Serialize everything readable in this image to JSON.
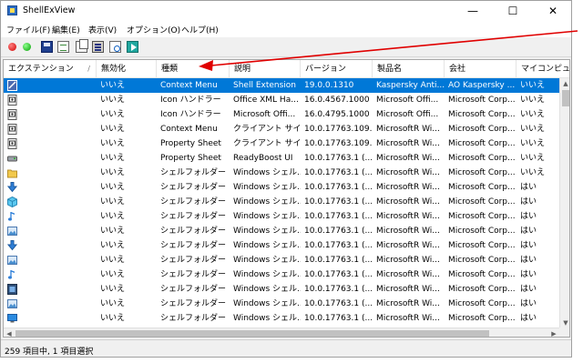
{
  "window": {
    "title": "ShellExView",
    "min_glyph": "—",
    "max_glyph": "☐",
    "close_glyph": "✕"
  },
  "menu": [
    "ファイル(F)",
    "編集(E)",
    "表示(V)",
    "オプション(O)",
    "ヘルプ(H)"
  ],
  "toolbar": [
    "red-dot-icon",
    "green-dot-icon",
    "save-icon",
    "refresh-icon",
    "copy-icon",
    "properties-icon",
    "find-icon",
    "exit-icon"
  ],
  "columns": [
    "エクステンション",
    "無効化",
    "種類",
    "説明",
    "バージョン",
    "製品名",
    "会社",
    "マイコンピュータ"
  ],
  "sort_indicator": "/",
  "rows": [
    {
      "icon": "shell-ext-icon",
      "disabled": "いいえ",
      "type": "Context Menu",
      "desc": "Shell Extension",
      "version": "19.0.0.1310",
      "product": "Kaspersky Anti...",
      "company": "AO Kaspersky ...",
      "mycomputer": "いいえ",
      "selected": true
    },
    {
      "icon": "document-icon",
      "disabled": "いいえ",
      "type": "Icon ハンドラー",
      "desc": "Office XML Ha...",
      "version": "16.0.4567.1000",
      "product": "Microsoft Offi...",
      "company": "Microsoft Corp...",
      "mycomputer": "いいえ"
    },
    {
      "icon": "document-icon",
      "disabled": "いいえ",
      "type": "Icon ハンドラー",
      "desc": "Microsoft Offi...",
      "version": "16.0.4795.1000",
      "product": "Microsoft Offi...",
      "company": "Microsoft Corp...",
      "mycomputer": "いいえ"
    },
    {
      "icon": "document-icon",
      "disabled": "いいえ",
      "type": "Context Menu",
      "desc": "クライアント サイ...",
      "version": "10.0.17763.109...",
      "product": "MicrosoftR Wi...",
      "company": "Microsoft Corp...",
      "mycomputer": "いいえ"
    },
    {
      "icon": "document-icon",
      "disabled": "いいえ",
      "type": "Property Sheet",
      "desc": "クライアント サイ...",
      "version": "10.0.17763.109...",
      "product": "MicrosoftR Wi...",
      "company": "Microsoft Corp...",
      "mycomputer": "いいえ"
    },
    {
      "icon": "drive-icon",
      "disabled": "いいえ",
      "type": "Property Sheet",
      "desc": "ReadyBoost UI",
      "version": "10.0.17763.1 (...",
      "product": "MicrosoftR Wi...",
      "company": "Microsoft Corp...",
      "mycomputer": "いいえ"
    },
    {
      "icon": "folder-lock-icon",
      "disabled": "いいえ",
      "type": "シェルフォルダー",
      "desc": "Windows シェル...",
      "version": "10.0.17763.1 (...",
      "product": "MicrosoftR Wi...",
      "company": "Microsoft Corp...",
      "mycomputer": "いいえ"
    },
    {
      "icon": "download-arrow-icon",
      "disabled": "いいえ",
      "type": "シェルフォルダー",
      "desc": "Windows シェル...",
      "version": "10.0.17763.1 (...",
      "product": "MicrosoftR Wi...",
      "company": "Microsoft Corp...",
      "mycomputer": "はい"
    },
    {
      "icon": "cube-3d-icon",
      "disabled": "いいえ",
      "type": "シェルフォルダー",
      "desc": "Windows シェル...",
      "version": "10.0.17763.1 (...",
      "product": "MicrosoftR Wi...",
      "company": "Microsoft Corp...",
      "mycomputer": "はい"
    },
    {
      "icon": "music-note-icon",
      "disabled": "いいえ",
      "type": "シェルフォルダー",
      "desc": "Windows シェル...",
      "version": "10.0.17763.1 (...",
      "product": "MicrosoftR Wi...",
      "company": "Microsoft Corp...",
      "mycomputer": "はい"
    },
    {
      "icon": "picture-icon",
      "disabled": "いいえ",
      "type": "シェルフォルダー",
      "desc": "Windows シェル...",
      "version": "10.0.17763.1 (...",
      "product": "MicrosoftR Wi...",
      "company": "Microsoft Corp...",
      "mycomputer": "はい"
    },
    {
      "icon": "download-arrow-icon",
      "disabled": "いいえ",
      "type": "シェルフォルダー",
      "desc": "Windows シェル...",
      "version": "10.0.17763.1 (...",
      "product": "MicrosoftR Wi...",
      "company": "Microsoft Corp...",
      "mycomputer": "はい"
    },
    {
      "icon": "picture-icon",
      "disabled": "いいえ",
      "type": "シェルフォルダー",
      "desc": "Windows シェル...",
      "version": "10.0.17763.1 (...",
      "product": "MicrosoftR Wi...",
      "company": "Microsoft Corp...",
      "mycomputer": "はい"
    },
    {
      "icon": "music-note-icon",
      "disabled": "いいえ",
      "type": "シェルフォルダー",
      "desc": "Windows シェル...",
      "version": "10.0.17763.1 (...",
      "product": "MicrosoftR Wi...",
      "company": "Microsoft Corp...",
      "mycomputer": "はい"
    },
    {
      "icon": "video-icon",
      "disabled": "いいえ",
      "type": "シェルフォルダー",
      "desc": "Windows シェル...",
      "version": "10.0.17763.1 (...",
      "product": "MicrosoftR Wi...",
      "company": "Microsoft Corp...",
      "mycomputer": "はい"
    },
    {
      "icon": "picture-icon",
      "disabled": "いいえ",
      "type": "シェルフォルダー",
      "desc": "Windows シェル...",
      "version": "10.0.17763.1 (...",
      "product": "MicrosoftR Wi...",
      "company": "Microsoft Corp...",
      "mycomputer": "はい"
    },
    {
      "icon": "desktop-icon",
      "disabled": "いいえ",
      "type": "シェルフォルダー",
      "desc": "Windows シェル...",
      "version": "10.0.17763.1 (...",
      "product": "MicrosoftR Wi...",
      "company": "Microsoft Corp...",
      "mycomputer": "はい"
    },
    {
      "icon": "document-icon",
      "disabled": "いいえ",
      "type": "シェルフォルダー",
      "desc": "Windows シェル...",
      "version": "10.0.17763.1 (...",
      "product": "MicrosoftR Wi...",
      "company": "Microsoft Corp...",
      "mycomputer": "はい"
    }
  ],
  "status": "259 項目中, 1 項目選択",
  "colors": {
    "selection": "#0078d7",
    "annotation": "#e00000"
  }
}
